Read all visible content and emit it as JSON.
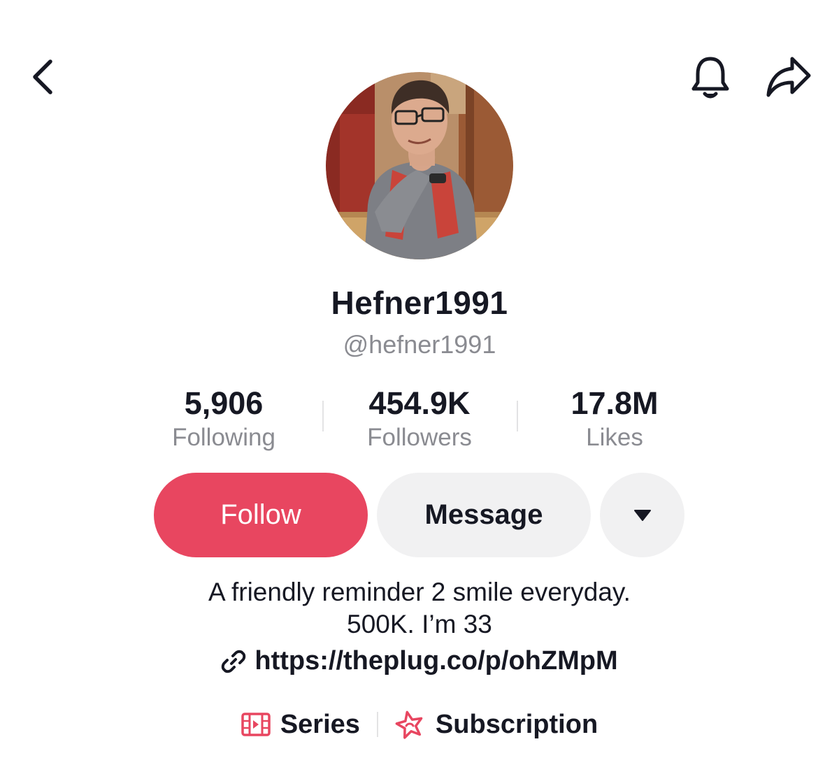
{
  "header": {
    "back_icon": "chevron-left-icon",
    "notification_icon": "bell-icon",
    "share_icon": "share-arrow-icon"
  },
  "profile": {
    "avatar": "profile-photo",
    "display_name": "Hefner1991",
    "username": "@hefner1991"
  },
  "stats": [
    {
      "value": "5,906",
      "label": "Following"
    },
    {
      "value": "454.9K",
      "label": "Followers"
    },
    {
      "value": "17.8M",
      "label": "Likes"
    }
  ],
  "actions": {
    "follow_label": "Follow",
    "message_label": "Message",
    "more_icon": "caret-down-icon"
  },
  "bio": {
    "line1": "A friendly reminder 2 smile everyday.",
    "line2": "500K. I’m 33",
    "link_icon": "link-icon",
    "link": "https://theplug.co/p/ohZMpM"
  },
  "features": [
    {
      "icon": "series-icon",
      "label": "Series"
    },
    {
      "icon": "subscription-icon",
      "label": "Subscription"
    }
  ],
  "colors": {
    "follow_button": "#e84660",
    "secondary_button": "#f1f1f2",
    "muted_text": "#8a8b91",
    "primary_text": "#161823",
    "feature_accent": "#e84660"
  }
}
